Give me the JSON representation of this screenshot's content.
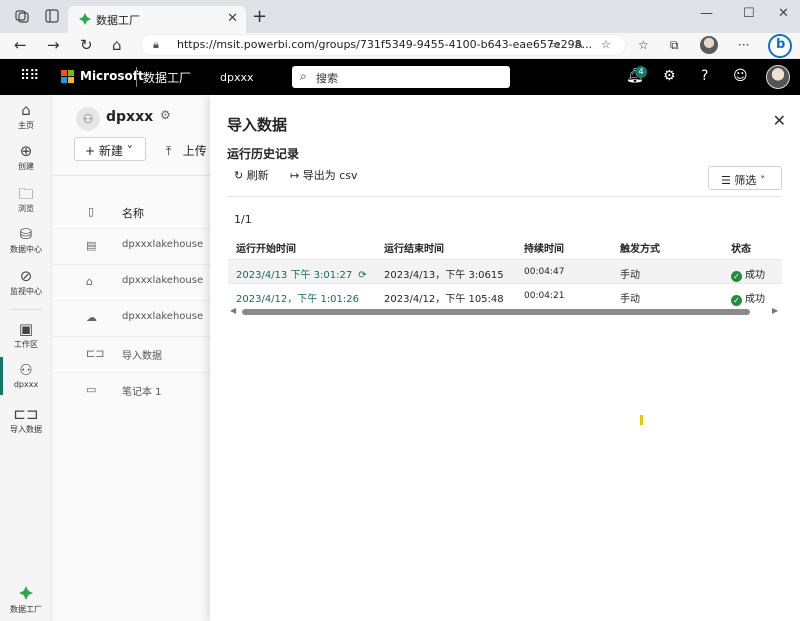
{
  "browser": {
    "tab_title": "数据工厂",
    "url": "https://msit.powerbi.com/groups/731f5349-9455-4100-b643-eae657e298..."
  },
  "header": {
    "brand": "Microsoft",
    "app_name": "数据工厂",
    "workspace": "dpxxx",
    "search_placeholder": "搜索",
    "notification_count": "4",
    "help": "?"
  },
  "rail": {
    "items": [
      {
        "label": "主页",
        "icon": "home-icon"
      },
      {
        "label": "创建",
        "icon": "plus-circle-icon"
      },
      {
        "label": "浏览",
        "icon": "folder-icon"
      },
      {
        "label": "数据中心",
        "icon": "data-hub-icon"
      },
      {
        "label": "监视中心",
        "icon": "monitor-icon"
      },
      {
        "label": "工作区",
        "icon": "workspaces-icon"
      },
      {
        "label": "dpxxx",
        "icon": "workspace-icon"
      },
      {
        "label": "导入数据",
        "icon": "pipeline-icon"
      },
      {
        "label": "数据工厂",
        "icon": "data-factory-icon"
      }
    ]
  },
  "workspace": {
    "title": "dpxxx",
    "new_label": "新建",
    "upload_label": "上传",
    "column_name": "名称",
    "items": [
      {
        "name": "dpxxxlakehouse",
        "icon": "sql-endpoint-icon"
      },
      {
        "name": "dpxxxlakehouse",
        "icon": "lakehouse-icon"
      },
      {
        "name": "dpxxxlakehouse",
        "icon": "dataset-icon"
      },
      {
        "name": "导入数据",
        "icon": "pipeline-icon"
      },
      {
        "name": "笔记本 1",
        "icon": "notebook-icon"
      }
    ]
  },
  "panel": {
    "title": "导入数据",
    "subtitle": "运行历史记录",
    "refresh_label": "刷新",
    "export_label": "导出为 csv",
    "filter_label": "筛选",
    "page_count": "1/1",
    "columns": {
      "start": "运行开始时间",
      "end": "运行结束时间",
      "duration": "持续时间",
      "trigger": "触发方式",
      "status": "状态"
    },
    "rows": [
      {
        "start": "2023/4/13 下午 3:01:27",
        "end": "2023/4/13，下午 3:0615",
        "duration": "00:04:47",
        "trigger": "手动",
        "status": "成功"
      },
      {
        "start": "2023/4/12，下午 1:01:26",
        "end": "2023/4/12，下午 105:48",
        "duration": "00:04:21",
        "trigger": "手动",
        "status": "成功"
      }
    ]
  },
  "colors": {
    "accent": "#117865",
    "link": "#0e6e5c",
    "success": "#1e8f3d",
    "header_bg": "#000000"
  }
}
